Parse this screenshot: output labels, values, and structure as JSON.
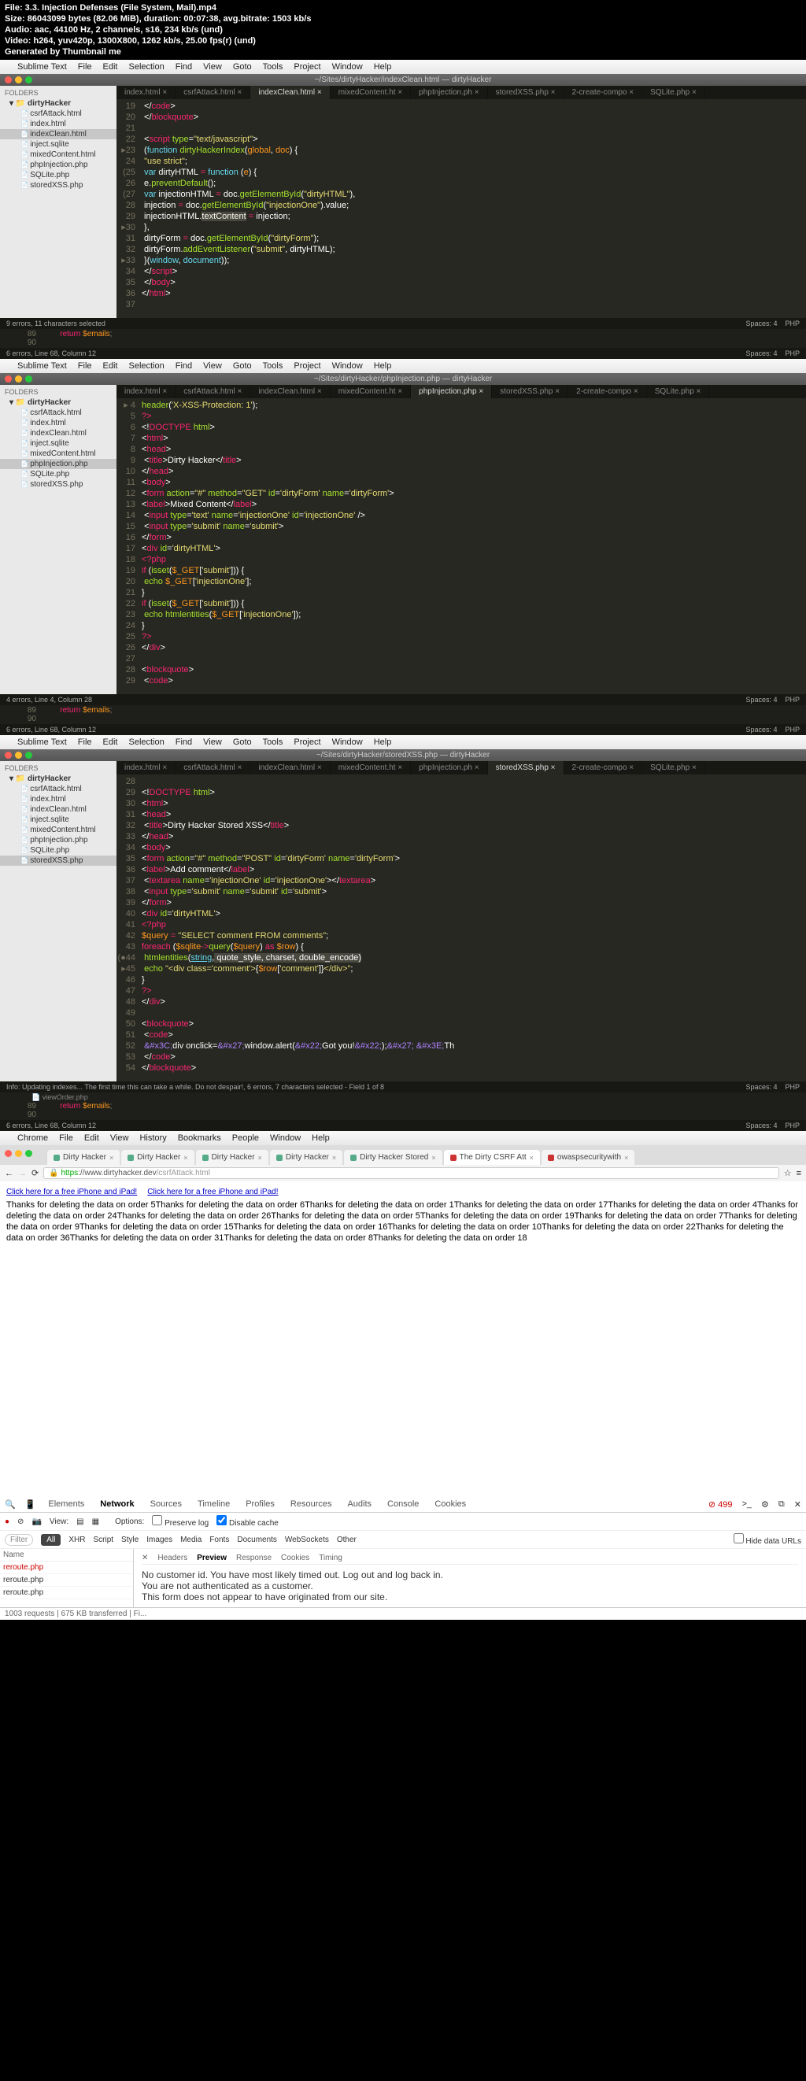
{
  "video_info": {
    "file": "File: 3.3. Injection Defenses (File System, Mail).mp4",
    "size": "Size: 86043099 bytes (82.06 MiB), duration: 00:07:38, avg.bitrate: 1503 kb/s",
    "audio": "Audio: aac, 44100 Hz, 2 channels, s16, 234 kb/s (und)",
    "video": "Video: h264, yuv420p, 1300X800, 1262 kb/s, 25.00 fps(r) (und)",
    "gen": "Generated by Thumbnail me"
  },
  "menubar": {
    "apple": "",
    "items": [
      "Sublime Text",
      "File",
      "Edit",
      "View",
      "Selection",
      "Find",
      "View",
      "Goto",
      "Tools",
      "Project",
      "Window",
      "Help"
    ]
  },
  "menubar_full": [
    "Sublime Text",
    "File",
    "Edit",
    "Selection",
    "Find",
    "View",
    "Goto",
    "Tools",
    "Project",
    "Window",
    "Help"
  ],
  "chrome_menu": [
    "Chrome",
    "File",
    "Edit",
    "View",
    "History",
    "Bookmarks",
    "People",
    "Window",
    "Help"
  ],
  "pane1": {
    "title": "~/Sites/dirtyHacker/indexClean.html — dirtyHacker",
    "folders": "FOLDERS",
    "root": "dirtyHacker",
    "files": [
      "csrfAttack.html",
      "index.html",
      "indexClean.html",
      "inject.sqlite",
      "mixedContent.html",
      "phpInjection.php",
      "SQLite.php",
      "storedXSS.php"
    ],
    "active": "indexClean.html",
    "tabs": [
      "index.html",
      "csrfAttack.html",
      "indexClean.html",
      "mixedContent.ht",
      "phpInjection.ph",
      "storedXSS.php",
      "2-create-compo",
      "SQLite.php"
    ],
    "activeTab": "indexClean.html",
    "status": "9 errors, 11 characters selected",
    "spaces": "Spaces: 4",
    "lang": "PHP",
    "statStrip": "6 errors, Line 68, Column 12",
    "return": "return $emails;"
  },
  "pane2": {
    "title": "~/Sites/dirtyHacker/phpInjection.php — dirtyHacker",
    "files": [
      "csrfAttack.html",
      "index.html",
      "indexClean.html",
      "inject.sqlite",
      "mixedContent.html",
      "phpInjection.php",
      "SQLite.php",
      "storedXSS.php"
    ],
    "active": "phpInjection.php",
    "tabs": [
      "index.html",
      "csrfAttack.html",
      "indexClean.html",
      "mixedContent.ht",
      "phpInjection.php",
      "storedXSS.php",
      "2-create-compo",
      "SQLite.php"
    ],
    "activeTab": "phpInjection.php",
    "status": "4 errors, Line 4, Column 28",
    "spaces": "Spaces: 4",
    "lang": "PHP",
    "return": "return $emails;",
    "statStrip": "6 errors, Line 68, Column 12"
  },
  "pane3": {
    "title": "~/Sites/dirtyHacker/storedXSS.php — dirtyHacker",
    "files": [
      "csrfAttack.html",
      "index.html",
      "indexClean.html",
      "inject.sqlite",
      "mixedContent.html",
      "phpInjection.php",
      "SQLite.php",
      "storedXSS.php"
    ],
    "active": "storedXSS.php",
    "tabs": [
      "index.html",
      "csrfAttack.html",
      "indexClean.html",
      "mixedContent.ht",
      "phpInjection.ph",
      "storedXSS.php",
      "2-create-compo",
      "SQLite.php"
    ],
    "activeTab": "storedXSS.php",
    "status": "Info: Updating indexes... The first time this can take a while. Do not despair!, 6 errors, 7 characters selected - Field 1 of 8",
    "spaces": "Spaces: 4",
    "lang": "PHP",
    "return": "return $emails;",
    "stripfile": "viewOrder.php",
    "statStrip": "6 errors, Line 68, Column 12"
  },
  "browser": {
    "tabs": [
      "Dirty Hacker",
      "Dirty Hacker",
      "Dirty Hacker",
      "Dirty Hacker",
      "Dirty Hacker Stored",
      "The Dirty CSRF Att",
      "owaspsecuritywith"
    ],
    "activeTab": 5,
    "url": "https://www.dirtyhacker.dev/csrfAttack.html",
    "ads": [
      "Click here for a free iPhone and iPad!",
      "Click here for a free iPhone and iPad!"
    ],
    "body": "Thanks for deleting the data on order 5Thanks for deleting the data on order 6Thanks for deleting the data on order 1Thanks for deleting the data on order 17Thanks for deleting the data on order 4Thanks for deleting the data on order 24Thanks for deleting the data on order 26Thanks for deleting the data on order 5Thanks for deleting the data on order 19Thanks for deleting the data on order 7Thanks for deleting the data on order 9Thanks for deleting the data on order 15Thanks for deleting the data on order 16Thanks for deleting the data on order 10Thanks for deleting the data on order 22Thanks for deleting the data on order 36Thanks for deleting the data on order 31Thanks for deleting the data on order 8Thanks for deleting the data on order 18"
  },
  "devtools": {
    "err": "499",
    "tabs": [
      "Elements",
      "Network",
      "Sources",
      "Timeline",
      "Profiles",
      "Resources",
      "Audits",
      "Console",
      "Cookies"
    ],
    "active": "Network",
    "opt": {
      "view": "View:",
      "options": "Options:",
      "preserve": "Preserve log",
      "disable": "Disable cache"
    },
    "filter": "Filter",
    "filters": [
      "All",
      "XHR",
      "Script",
      "Style",
      "Images",
      "Media",
      "Fonts",
      "Documents",
      "WebSockets",
      "Other"
    ],
    "hide": "Hide data URLs",
    "name": "Name",
    "rows": [
      "reroute.php",
      "reroute.php",
      "reroute.php"
    ],
    "preview_tabs": [
      "Headers",
      "Preview",
      "Response",
      "Cookies",
      "Timing"
    ],
    "preview_sel": "Preview",
    "preview": {
      "l1": "No customer id. You have most likely timed out. Log out and log back in.",
      "l2": "You are not authenticated as a customer.",
      "l3": "This form does not appear to have originated from our site."
    },
    "footer": "1003 requests | 675 KB transferred | Fi..."
  },
  "code1": [
    {
      "n": "19",
      "h": "      &lt;/<span class='t'>code</span>&gt;"
    },
    {
      "n": "20",
      "h": "  &lt;/<span class='t'>blockquote</span>&gt;"
    },
    {
      "n": "21",
      "h": ""
    },
    {
      "n": "22",
      "h": "  &lt;<span class='t'>script</span> <span class='n'>type</span>=<span class='s'>\"text/javascript\"</span>&gt;"
    },
    {
      "n": "▸23",
      "h": "  (<span class='f'>function</span> <span class='n'>dirtyHackerIndex</span>(<span class='o'>global</span>, <span class='o'>doc</span>) {"
    },
    {
      "n": "24",
      "h": "    <span class='s'>\"use strict\"</span>;"
    },
    {
      "n": "(25",
      "h": "    <span class='f'>var</span> <span class='p'>dirtyHTML</span> <span class='t'>=</span> <span class='f'>function</span> (<span class='o'>e</span>) {"
    },
    {
      "n": "26",
      "h": "        e.<span class='n'>preventDefault</span>();"
    },
    {
      "n": "(27",
      "h": "        <span class='f'>var</span> injectionHTML <span class='t'>=</span> doc.<span class='n'>getElementById</span>(<span class='s'>\"dirtyHTML\"</span>),"
    },
    {
      "n": "28",
      "h": "            injection <span class='t'>=</span> doc.<span class='n'>getElementById</span>(<span class='s'>\"injectionOne\"</span>).value;"
    },
    {
      "n": "29",
      "h": "        injectionHTML.<span class='p' style='background:#49483e'>textContent</span> <span class='t'>=</span> injection;"
    },
    {
      "n": "▸30",
      "h": "      },"
    },
    {
      "n": "31",
      "h": "        dirtyForm <span class='t'>=</span> doc.<span class='n'>getElementById</span>(<span class='s'>\"dirtyForm\"</span>);"
    },
    {
      "n": "32",
      "h": "        dirtyForm.<span class='n'>addEventListener</span>(<span class='s'>\"submit\"</span>, dirtyHTML);"
    },
    {
      "n": "▸33",
      "h": "  }(<span class='f'>window</span>, <span class='f'>document</span>));"
    },
    {
      "n": "34",
      "h": "  &lt;/<span class='t'>script</span>&gt;"
    },
    {
      "n": "35",
      "h": "  &lt;/<span class='t'>body</span>&gt;"
    },
    {
      "n": "36",
      "h": "&lt;/<span class='t'>html</span>&gt;"
    },
    {
      "n": "37",
      "h": ""
    }
  ],
  "code2": [
    {
      "n": "▸ 4",
      "h": "<span class='n'>header</span>(<span class='s'>'X-XSS-Protection: 1'</span>);"
    },
    {
      "n": "5",
      "h": "<span class='t'>?&gt;</span>"
    },
    {
      "n": "6",
      "h": "&lt;!<span class='t'>DOCTYPE</span> <span class='n'>html</span>&gt;"
    },
    {
      "n": "7",
      "h": "&lt;<span class='t'>html</span>&gt;"
    },
    {
      "n": "8",
      "h": "&lt;<span class='t'>head</span>&gt;"
    },
    {
      "n": "9",
      "h": "    &lt;<span class='t'>title</span>&gt;Dirty Hacker&lt;/<span class='t'>title</span>&gt;"
    },
    {
      "n": "10",
      "h": "&lt;/<span class='t'>head</span>&gt;"
    },
    {
      "n": "11",
      "h": "&lt;<span class='t'>body</span>&gt;"
    },
    {
      "n": "12",
      "h": "&lt;<span class='t'>form</span> <span class='n'>action</span>=<span class='s'>\"#\"</span> <span class='n'>method</span>=<span class='s'>\"GET\"</span> <span class='n'>id</span>=<span class='s'>'dirtyForm'</span> <span class='n'>name</span>=<span class='s'>'dirtyForm'</span>&gt;"
    },
    {
      "n": "13",
      "h": "&lt;<span class='t'>label</span>&gt;Mixed Content&lt;/<span class='t'>label</span>&gt;"
    },
    {
      "n": "14",
      "h": "    &lt;<span class='t'>input</span> <span class='n'>type</span>=<span class='s'>'text'</span> <span class='n'>name</span>=<span class='s'>'injectionOne'</span> <span class='n'>id</span>=<span class='s'>'injectionOne'</span> /&gt;"
    },
    {
      "n": "15",
      "h": "    &lt;<span class='t'>input</span> <span class='n'>type</span>=<span class='s'>'submit'</span> <span class='n'>name</span>=<span class='s'>'submit'</span>&gt;"
    },
    {
      "n": "16",
      "h": "&lt;/<span class='t'>form</span>&gt;"
    },
    {
      "n": "17",
      "h": "&lt;<span class='t'>div</span> <span class='n'>id</span>=<span class='s'>'dirtyHTML'</span>&gt;"
    },
    {
      "n": "18",
      "h": "<span class='t'>&lt;?php</span>"
    },
    {
      "n": "19",
      "h": "<span class='t'>if</span> (<span class='n'>isset</span>(<span class='o'>$_GET</span>[<span class='s'>'submit'</span>])) {"
    },
    {
      "n": "20",
      "h": "    <span class='n'>echo</span> <span class='o'>$_GET</span>[<span class='s'>'injectionOne'</span>];"
    },
    {
      "n": "21",
      "h": "}"
    },
    {
      "n": "22",
      "h": "<span class='t'>if</span> (<span class='n'>isset</span>(<span class='o'>$_GET</span>[<span class='s'>'submit'</span>])) {"
    },
    {
      "n": "23",
      "h": "    <span class='n'>echo</span> <span class='n'>htmlentities</span>(<span class='o'>$_GET</span>[<span class='s'>'injectionOne'</span>]);"
    },
    {
      "n": "24",
      "h": "}"
    },
    {
      "n": "25",
      "h": "<span class='t'>?&gt;</span>"
    },
    {
      "n": "26",
      "h": "&lt;/<span class='t'>div</span>&gt;"
    },
    {
      "n": "27",
      "h": ""
    },
    {
      "n": "28",
      "h": "&lt;<span class='t'>blockquote</span>&gt;"
    },
    {
      "n": "29",
      "h": "    &lt;<span class='t'>code</span>&gt;"
    }
  ],
  "code3": [
    {
      "n": "28",
      "h": ""
    },
    {
      "n": "29",
      "h": "&lt;!<span class='t'>DOCTYPE</span> <span class='n'>html</span>&gt;"
    },
    {
      "n": "30",
      "h": "&lt;<span class='t'>html</span>&gt;"
    },
    {
      "n": "31",
      "h": "&lt;<span class='t'>head</span>&gt;"
    },
    {
      "n": "32",
      "h": "    &lt;<span class='t'>title</span>&gt;Dirty Hacker Stored XSS&lt;/<span class='t'>title</span>&gt;"
    },
    {
      "n": "33",
      "h": "&lt;/<span class='t'>head</span>&gt;"
    },
    {
      "n": "34",
      "h": "&lt;<span class='t'>body</span>&gt;"
    },
    {
      "n": "35",
      "h": "&lt;<span class='t'>form</span> <span class='n'>action</span>=<span class='s'>\"#\"</span> <span class='n'>method</span>=<span class='s'>\"POST\"</span> <span class='n'>id</span>=<span class='s'>'dirtyForm'</span> <span class='n'>name</span>=<span class='s'>'dirtyForm'</span>&gt;"
    },
    {
      "n": "36",
      "h": "&lt;<span class='t'>label</span>&gt;Add comment&lt;/<span class='t'>label</span>&gt;"
    },
    {
      "n": "37",
      "h": "    &lt;<span class='t'>textarea</span> <span class='n'>name</span>=<span class='s'>'injectionOne'</span> <span class='n'>id</span>=<span class='s'>'injectionOne'</span>&gt;&lt;/<span class='t'>textarea</span>&gt;"
    },
    {
      "n": "38",
      "h": "    &lt;<span class='t'>input</span> <span class='n'>type</span>=<span class='s'>'submit'</span> <span class='n'>name</span>=<span class='s'>'submit'</span> <span class='n'>id</span>=<span class='s'>'submit'</span>&gt;"
    },
    {
      "n": "39",
      "h": "&lt;/<span class='t'>form</span>&gt;"
    },
    {
      "n": "40",
      "h": "&lt;<span class='t'>div</span> <span class='n'>id</span>=<span class='s'>'dirtyHTML'</span>&gt;"
    },
    {
      "n": "41",
      "h": "<span class='t'>&lt;?php</span>"
    },
    {
      "n": "42",
      "h": "<span class='o'>$query</span> <span class='t'>=</span> <span class='s'>\"SELECT comment FROM comments\"</span>;"
    },
    {
      "n": "43",
      "h": "<span class='t'>foreach</span> (<span class='o'>$sqlite</span><span class='t'>-&gt;</span><span class='n'>query</span>(<span class='o'>$query</span>) <span class='t'>as</span> <span class='o'>$row</span>) {"
    },
    {
      "n": "(●44",
      "h": "    <span class='n'>htmlentities</span>(<span class='f'><u>string</u></span>,<span style='background:#49483e'> quote_style, charset, double_encode)</span>"
    },
    {
      "n": "▸45",
      "h": "    <span class='n'>echo</span> <span class='s'>\"&lt;div class='comment'&gt;</span>{<span class='o'>$row</span>[<span class='s'>'comment'</span>]}<span class='s'>&lt;/div&gt;\"</span>;"
    },
    {
      "n": "46",
      "h": "}"
    },
    {
      "n": "47",
      "h": "<span class='t'>?&gt;</span>"
    },
    {
      "n": "48",
      "h": "&lt;/<span class='t'>div</span>&gt;"
    },
    {
      "n": "49",
      "h": ""
    },
    {
      "n": "50",
      "h": "&lt;<span class='t'>blockquote</span>&gt;"
    },
    {
      "n": "51",
      "h": "    &lt;<span class='t'>code</span>&gt;"
    },
    {
      "n": "52",
      "h": "        <span class='c'>&amp;#x3C;</span>div onclick=<span class='c'>&amp;#x27;</span>window.alert(<span class='c'>&amp;#x22;</span>Got you!<span class='c'>&amp;#x22;</span>);<span class='c'>&amp;#x27;</span>&nbsp;<span class='c'>&amp;#x3E;</span>Th"
    },
    {
      "n": "53",
      "h": "    &lt;/<span class='t'>code</span>&gt;"
    },
    {
      "n": "54",
      "h": "&lt;/<span class='t'>blockquote</span>&gt;"
    }
  ]
}
